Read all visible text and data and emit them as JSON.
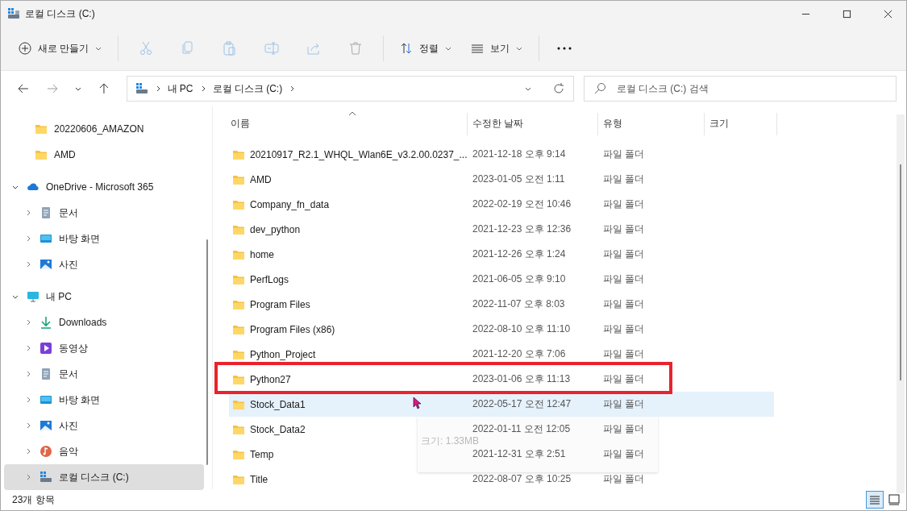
{
  "window": {
    "title": "로컬 디스크 (C:)"
  },
  "toolbar": {
    "new": "새로 만들기",
    "sort": "정렬",
    "view": "보기"
  },
  "address": {
    "crumbs": [
      "내 PC",
      "로컬 디스크 (C:)"
    ],
    "search_placeholder": "로컬 디스크 (C:) 검색"
  },
  "sidebar": {
    "items": [
      {
        "label": "20220606_AMAZON",
        "kind": "quick-folder",
        "selected": false
      },
      {
        "label": "AMD",
        "kind": "quick-folder",
        "selected": false
      },
      {
        "label": "OneDrive - Microsoft 365",
        "kind": "cloud",
        "expanded": true,
        "selected": false,
        "children": [
          {
            "label": "문서",
            "kind": "documents",
            "expanded": false,
            "selected": false
          },
          {
            "label": "바탕 화면",
            "kind": "desktop",
            "expanded": false,
            "selected": false
          },
          {
            "label": "사진",
            "kind": "pictures",
            "expanded": false,
            "selected": false
          }
        ]
      },
      {
        "label": "내 PC",
        "kind": "pc",
        "expanded": true,
        "selected": false,
        "children": [
          {
            "label": "Downloads",
            "kind": "download",
            "expanded": false,
            "selected": false
          },
          {
            "label": "동영상",
            "kind": "video",
            "expanded": false,
            "selected": false
          },
          {
            "label": "문서",
            "kind": "documents",
            "expanded": false,
            "selected": false
          },
          {
            "label": "바탕 화면",
            "kind": "desktop",
            "expanded": false,
            "selected": false
          },
          {
            "label": "사진",
            "kind": "pictures",
            "expanded": false,
            "selected": false
          },
          {
            "label": "음악",
            "kind": "music",
            "expanded": false,
            "selected": false
          },
          {
            "label": "로컬 디스크 (C:)",
            "kind": "drive",
            "expanded": false,
            "selected": true
          }
        ]
      }
    ]
  },
  "table": {
    "columns": [
      "이름",
      "수정한 날짜",
      "유형",
      "크기"
    ],
    "rows": [
      {
        "name": "20210917_R2.1_WHQL_Wlan6E_v3.2.00.0237_...",
        "date": "2021-12-18 오후 9:14",
        "type": "파일 폴더",
        "selected": false,
        "marked": false
      },
      {
        "name": "AMD",
        "date": "2023-01-05 오전 1:11",
        "type": "파일 폴더",
        "selected": false,
        "marked": false
      },
      {
        "name": "Company_fn_data",
        "date": "2022-02-19 오전 10:46",
        "type": "파일 폴더",
        "selected": false,
        "marked": false
      },
      {
        "name": "dev_python",
        "date": "2021-12-23 오후 12:36",
        "type": "파일 폴더",
        "selected": false,
        "marked": false
      },
      {
        "name": "home",
        "date": "2021-12-26 오후 1:24",
        "type": "파일 폴더",
        "selected": false,
        "marked": false
      },
      {
        "name": "PerfLogs",
        "date": "2021-06-05 오후 9:10",
        "type": "파일 폴더",
        "selected": false,
        "marked": false
      },
      {
        "name": "Program Files",
        "date": "2022-11-07 오후 8:03",
        "type": "파일 폴더",
        "selected": false,
        "marked": false
      },
      {
        "name": "Program Files (x86)",
        "date": "2022-08-10 오후 11:10",
        "type": "파일 폴더",
        "selected": false,
        "marked": false
      },
      {
        "name": "Python_Project",
        "date": "2021-12-20 오후 7:06",
        "type": "파일 폴더",
        "selected": false,
        "marked": false
      },
      {
        "name": "Python27",
        "date": "2023-01-06 오후 11:13",
        "type": "파일 폴더",
        "selected": false,
        "marked": true
      },
      {
        "name": "Stock_Data1",
        "date": "2022-05-17 오전 12:47",
        "type": "파일 폴더",
        "selected": true,
        "marked": false
      },
      {
        "name": "Stock_Data2",
        "date": "2022-01-11 오전 12:05",
        "type": "파일 폴더",
        "selected": false,
        "marked": false
      },
      {
        "name": "Temp",
        "date": "2021-12-31 오후 2:51",
        "type": "파일 폴더",
        "selected": false,
        "marked": false
      },
      {
        "name": "Title",
        "date": "2022-08-07 오후 10:25",
        "type": "파일 폴더",
        "selected": false,
        "marked": false
      }
    ]
  },
  "tooltip": {
    "lines": [
      "크기: 1.33MB"
    ]
  },
  "status_bar": {
    "count": "23개 항목",
    "view_modes": [
      {
        "kind": "details",
        "selected": true
      },
      {
        "kind": "tiles",
        "selected": false
      }
    ]
  }
}
